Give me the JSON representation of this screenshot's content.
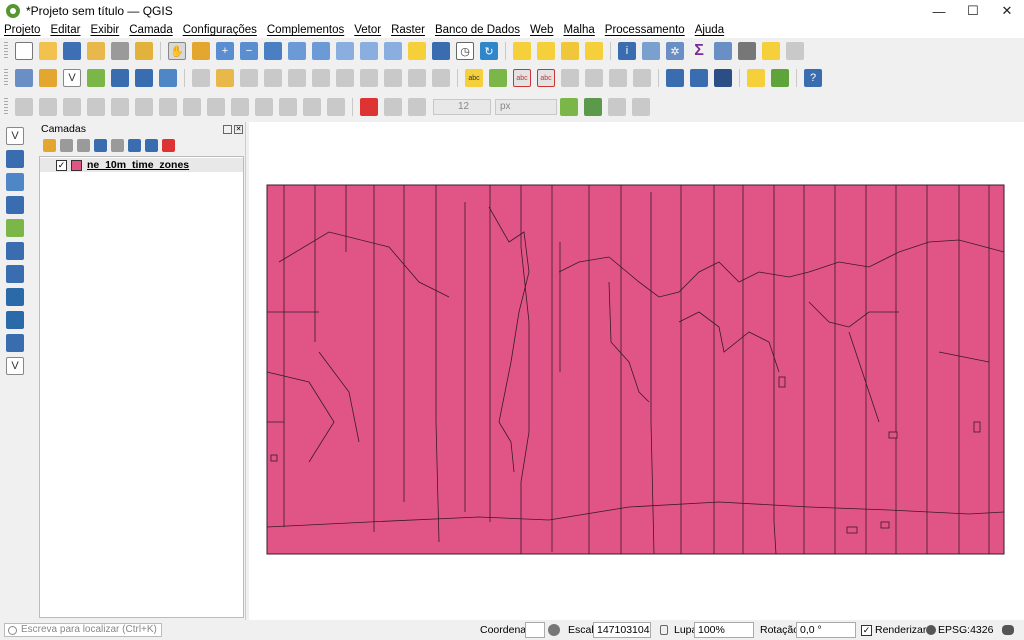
{
  "window": {
    "title": "*Projeto sem título — QGIS",
    "minimize": "—",
    "maximize": "☐",
    "close": "✕"
  },
  "menu": [
    "Projeto",
    "Editar",
    "Exibir",
    "Camada",
    "Configurações",
    "Complementos",
    "Vetor",
    "Raster",
    "Banco de Dados",
    "Web",
    "Malha",
    "Processamento",
    "Ajuda"
  ],
  "toolbars": {
    "row1": [
      "new-project-icon",
      "open-project-icon",
      "save-project-icon",
      "save-as-icon",
      "print-layout-icon",
      "layout-manager-icon",
      "pan-icon",
      "pan-to-selection-icon",
      "zoom-in-icon",
      "zoom-out-icon",
      "zoom-full-icon",
      "zoom-to-selection-icon",
      "zoom-to-layer-icon",
      "zoom-native-icon",
      "zoom-last-icon",
      "zoom-next-icon",
      "new-bookmark-icon",
      "show-bookmarks-icon",
      "temporal-icon",
      "refresh-icon",
      "select-feature-icon",
      "deselect-icon",
      "select-by-expression-icon",
      "deselect-all-icon",
      "identify-icon",
      "attribute-table-icon",
      "field-calculator-icon",
      "statistics-icon",
      "open-table-icon",
      "measure-icon",
      "map-tips-icon",
      "annotation-icon"
    ],
    "row2": [
      "data-source-manager-icon",
      "new-geopackage-icon",
      "new-shapefile-icon",
      "new-spatialite-icon",
      "new-memory-layer-icon",
      "new-virtual-layer-icon",
      "add-raster-icon",
      "current-edits-icon",
      "toggle-editing-icon",
      "save-edits-icon",
      "digitize-icon",
      "vertex-tool-icon",
      "delete-selected-icon",
      "cut-icon",
      "copy-icon",
      "paste-icon",
      "undo-icon",
      "redo-icon",
      "label-toolbar-icon",
      "diagram-icon",
      "label-pin-icon",
      "label-highlight-icon",
      "label-show-icon",
      "label-move-icon",
      "label-rotate-icon",
      "label-change-icon",
      "metasearch-icon",
      "python-console-icon",
      "processing-icon",
      "help-icon"
    ],
    "row3": [
      "advanced-digitizing-icon",
      "add-ring-icon",
      "add-part-icon",
      "fill-ring-icon",
      "delete-ring-icon",
      "delete-part-icon",
      "reshape-icon",
      "offset-curve-icon",
      "split-features-icon",
      "split-parts-icon",
      "merge-selected-icon",
      "merge-attributes-icon",
      "rotate-point-symbols-icon",
      "offset-point-symbols-icon",
      "snapping-icon",
      "trace-icon",
      "tolerance-icon",
      "tracing-icon",
      "topology-icon"
    ],
    "snapping_value": "12",
    "snapping_unit": "px"
  },
  "left_toolbar": [
    "add-vector-icon",
    "add-raster-icon",
    "add-mesh-icon",
    "add-delimited-text-icon",
    "add-spatialite-icon",
    "add-postgis-icon",
    "add-wms-icon",
    "add-wfs-icon",
    "add-arcgis-icon",
    "add-virtual-layer-icon",
    "new-vector-icon"
  ],
  "layers_panel": {
    "title": "Camadas",
    "layers": [
      {
        "name": "ne_10m_time_zones",
        "checked": true,
        "color": "#e05586"
      }
    ]
  },
  "statusbar": {
    "search_placeholder": "Escreva para localizar (Ctrl+K)",
    "coordinate_label": "Coordenada",
    "coordinate_value": "",
    "scale_label": "Escala",
    "scale_value": "147103104",
    "magnifier_label": "Lupa",
    "magnifier_value": "100%",
    "rotation_label": "Rotação",
    "rotation_value": "0,0 °",
    "render_label": "Renderizar",
    "render_checked": true,
    "crs": "EPSG:4326"
  },
  "colors": {
    "layer_fill": "#e05586",
    "layer_outline": "#3a1a28"
  }
}
